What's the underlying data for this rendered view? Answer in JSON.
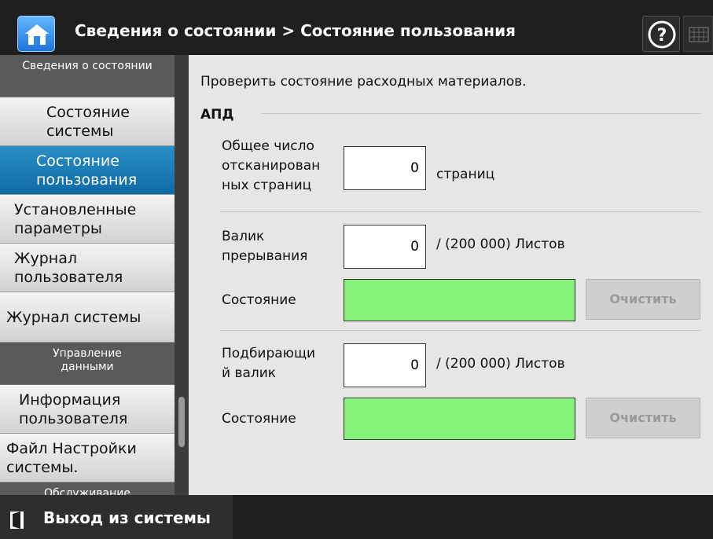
{
  "header": {
    "title": "Сведения о состоянии > Состояние пользования",
    "home_icon": "home-icon",
    "help_icon": "help-icon",
    "keyboard_icon": "keyboard-icon"
  },
  "sidebar": {
    "groups": [
      {
        "label": "Сведения о состоянии"
      },
      {
        "label": "Управление данными"
      },
      {
        "label": "Обслуживание"
      }
    ],
    "items": [
      {
        "label": "Состояние системы"
      },
      {
        "label": "Состояние пользования"
      },
      {
        "label": "Установленные параметры"
      },
      {
        "label": "Журнал пользователя"
      },
      {
        "label": "Журнал системы"
      },
      {
        "label": "Информация пользователя"
      },
      {
        "label": "Файл Настройки системы."
      }
    ]
  },
  "main": {
    "description": "Проверить состояние расходных материалов.",
    "section_title": "АПД",
    "total_pages": {
      "label": "Общее число отсканированных страниц",
      "label_lines": [
        "Общее число",
        "отсканирован",
        "ных страниц"
      ],
      "value": "0",
      "unit": "страниц"
    },
    "brake_roller": {
      "label_lines": [
        "Валик",
        "прерывания"
      ],
      "value": "0",
      "unit": "/ (200 000) Листов",
      "status_label": "Состояние",
      "status_color": "#86f27b",
      "status_level": 0,
      "clear_label": "Очистить"
    },
    "pick_roller": {
      "label_lines": [
        "Подбирающи",
        "й валик"
      ],
      "value": "0",
      "unit": "/ (200 000) Листов",
      "status_label": "Состояние",
      "status_color": "#86f27b",
      "status_level": 0,
      "clear_label": "Очистить"
    }
  },
  "footer": {
    "logout_label": "Выход из системы",
    "logout_icon": "logout-door-icon"
  }
}
